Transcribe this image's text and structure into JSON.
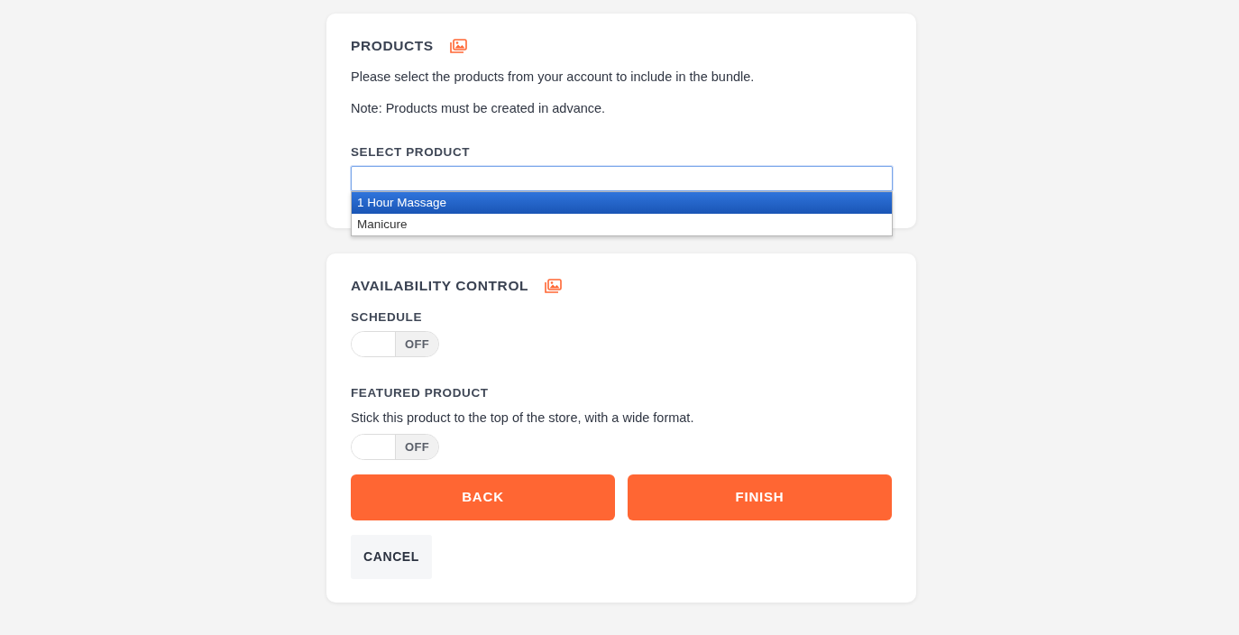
{
  "products_card": {
    "title": "PRODUCTS",
    "description": "Please select the products from your account to include in the bundle.",
    "note": "Note: Products must be created in advance.",
    "select_label": "SELECT PRODUCT",
    "select": {
      "expanded": true,
      "options": [
        {
          "label": "1 Hour Massage",
          "selected": true
        },
        {
          "label": "Manicure",
          "selected": false
        }
      ]
    }
  },
  "availability_card": {
    "title": "AVAILABILITY CONTROL",
    "settings": [
      {
        "label": "SCHEDULE",
        "toggle": {
          "text": "OFF",
          "on": false
        }
      },
      {
        "label": "FEATURED PRODUCT",
        "description": "Stick this product to the top of the store, with a wide format.",
        "toggle": {
          "text": "OFF",
          "on": false
        }
      }
    ]
  },
  "actions": [
    {
      "label": "BACK",
      "kind": "primary"
    },
    {
      "label": "FINISH",
      "kind": "primary"
    },
    {
      "label": "CANCEL",
      "kind": "secondary"
    }
  ]
}
